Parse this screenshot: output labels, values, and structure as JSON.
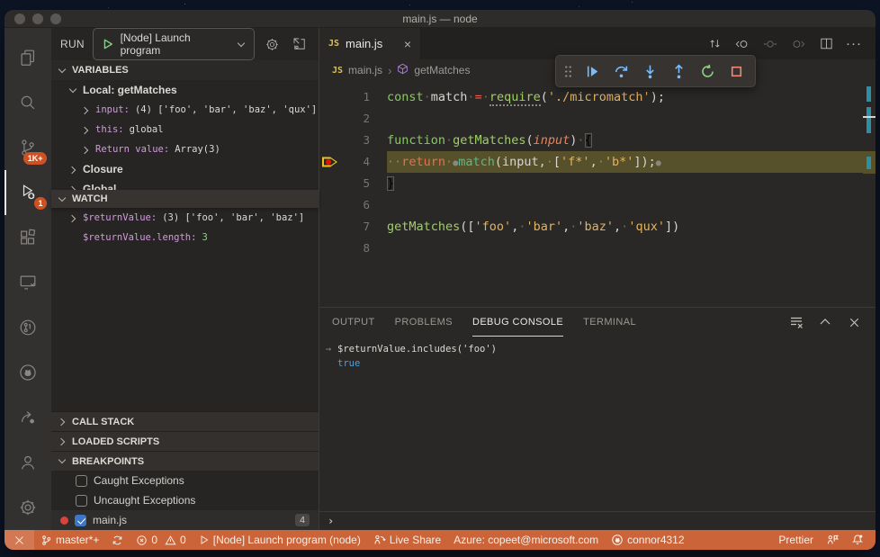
{
  "window": {
    "title": "main.js — node"
  },
  "icons": {
    "close": "×",
    "more": "···",
    "arrow": "→",
    "crumb_sep": "›"
  },
  "activity_bar": {
    "badges": {
      "source_control": "1K+",
      "debug": "1"
    }
  },
  "run_panel": {
    "run_label": "RUN",
    "config_label": "[Node] Launch program"
  },
  "sections": {
    "variables": {
      "title": "VARIABLES",
      "scope": "Local: getMatches",
      "rows": [
        {
          "name": "input:",
          "value": "(4) ['foo', 'bar', 'baz', 'qux']"
        },
        {
          "name": "this:",
          "value": "global"
        },
        {
          "name": "Return value:",
          "value": "Array(3)"
        }
      ],
      "closure": "Closure",
      "global": "Global"
    },
    "watch": {
      "title": "WATCH",
      "rows": [
        {
          "name": "$returnValue:",
          "value": "(3) ['foo', 'bar', 'baz']"
        },
        {
          "name": "$returnValue.length:",
          "value": "3"
        }
      ]
    },
    "call_stack": {
      "title": "CALL STACK"
    },
    "loaded_scripts": {
      "title": "LOADED SCRIPTS"
    },
    "breakpoints": {
      "title": "BREAKPOINTS",
      "items": [
        {
          "label": "Caught Exceptions",
          "checked": false
        },
        {
          "label": "Uncaught Exceptions",
          "checked": false
        },
        {
          "label": "main.js",
          "checked": true,
          "badge": "4",
          "has_dot": true
        }
      ]
    }
  },
  "editor": {
    "tab": {
      "label": "main.js",
      "language": "JS"
    },
    "breadcrumb": {
      "file": "main.js",
      "symbol": "getMatches"
    },
    "code": {
      "lines": [
        {
          "n": 1,
          "tokens": [
            [
              "kw",
              "const"
            ],
            [
              "ws",
              "·"
            ],
            [
              "pl",
              "match"
            ],
            [
              "ws",
              "·"
            ],
            [
              "op",
              "="
            ],
            [
              "ws",
              "·"
            ],
            [
              "fnu",
              "require"
            ],
            [
              "pl",
              "("
            ],
            [
              "st",
              "'./micromatch'"
            ],
            [
              "pl",
              ");"
            ]
          ]
        },
        {
          "n": 2,
          "tokens": []
        },
        {
          "n": 3,
          "tokens": [
            [
              "kw",
              "function"
            ],
            [
              "ws",
              "·"
            ],
            [
              "fn",
              "getMatches"
            ],
            [
              "pl",
              "("
            ],
            [
              "pa",
              "input"
            ],
            [
              "pl",
              ")"
            ],
            [
              "ws",
              "·"
            ],
            [
              "bx",
              "{"
            ]
          ]
        },
        {
          "n": 4,
          "current": true,
          "bp": true,
          "tokens": [
            [
              "ws",
              "··"
            ],
            [
              "ret",
              "return"
            ],
            [
              "ws",
              "·"
            ],
            [
              "dot",
              "●"
            ],
            [
              "call",
              "match"
            ],
            [
              "pl",
              "(input,"
            ],
            [
              "ws",
              "·"
            ],
            [
              "pl",
              "["
            ],
            [
              "st",
              "'f*'"
            ],
            [
              "pl",
              ","
            ],
            [
              "ws",
              "·"
            ],
            [
              "st",
              "'b*'"
            ],
            [
              "pl",
              "]);"
            ],
            [
              "dot",
              "●"
            ]
          ]
        },
        {
          "n": 5,
          "tokens": [
            [
              "bx",
              "}"
            ]
          ]
        },
        {
          "n": 6,
          "tokens": []
        },
        {
          "n": 7,
          "tokens": [
            [
              "fn",
              "getMatches"
            ],
            [
              "pl",
              "(["
            ],
            [
              "st",
              "'foo'"
            ],
            [
              "pl",
              ","
            ],
            [
              "ws",
              "·"
            ],
            [
              "st",
              "'bar'"
            ],
            [
              "pl",
              ","
            ],
            [
              "ws",
              "·"
            ],
            [
              "st",
              "'baz'"
            ],
            [
              "pl",
              ","
            ],
            [
              "ws",
              "·"
            ],
            [
              "st",
              "'qux'"
            ],
            [
              "pl",
              "])"
            ]
          ]
        },
        {
          "n": 8,
          "tokens": []
        }
      ]
    }
  },
  "panel": {
    "tabs": [
      {
        "label": "OUTPUT"
      },
      {
        "label": "PROBLEMS"
      },
      {
        "label": "DEBUG CONSOLE",
        "active": true
      },
      {
        "label": "TERMINAL"
      }
    ],
    "console": {
      "expression": "$returnValue.includes('foo')",
      "result": "true",
      "prompt": "›"
    }
  },
  "status_bar": {
    "branch": "master*+",
    "errors": "0",
    "warnings": "0",
    "debug_status": "[Node] Launch program (node)",
    "live_share": "Live Share",
    "azure": "Azure: copeet@microsoft.com",
    "account": "connor4312",
    "prettier": "Prettier"
  },
  "colors": {
    "status_bar": "#cb6438",
    "badge": "#ce5123",
    "debug_blue": "#75beff",
    "success_green": "#89d185",
    "error_red": "#f48771",
    "string_yellow": "#e3b25e",
    "keyword_green": "#8bc56c",
    "function_green": "#9fce67",
    "call_teal": "#52bd8a",
    "operator_red": "#e8604f",
    "param_orange": "#e8855c",
    "variable_purple": "#cf9bdb",
    "result_blue": "#4fa0d8",
    "breakpoint_red": "#e51400",
    "current_line": "#57512b",
    "arrow_yellow": "#f0c01d",
    "checkbox_blue": "#3d76c4",
    "modified_cyan": "#2d8fa5"
  }
}
